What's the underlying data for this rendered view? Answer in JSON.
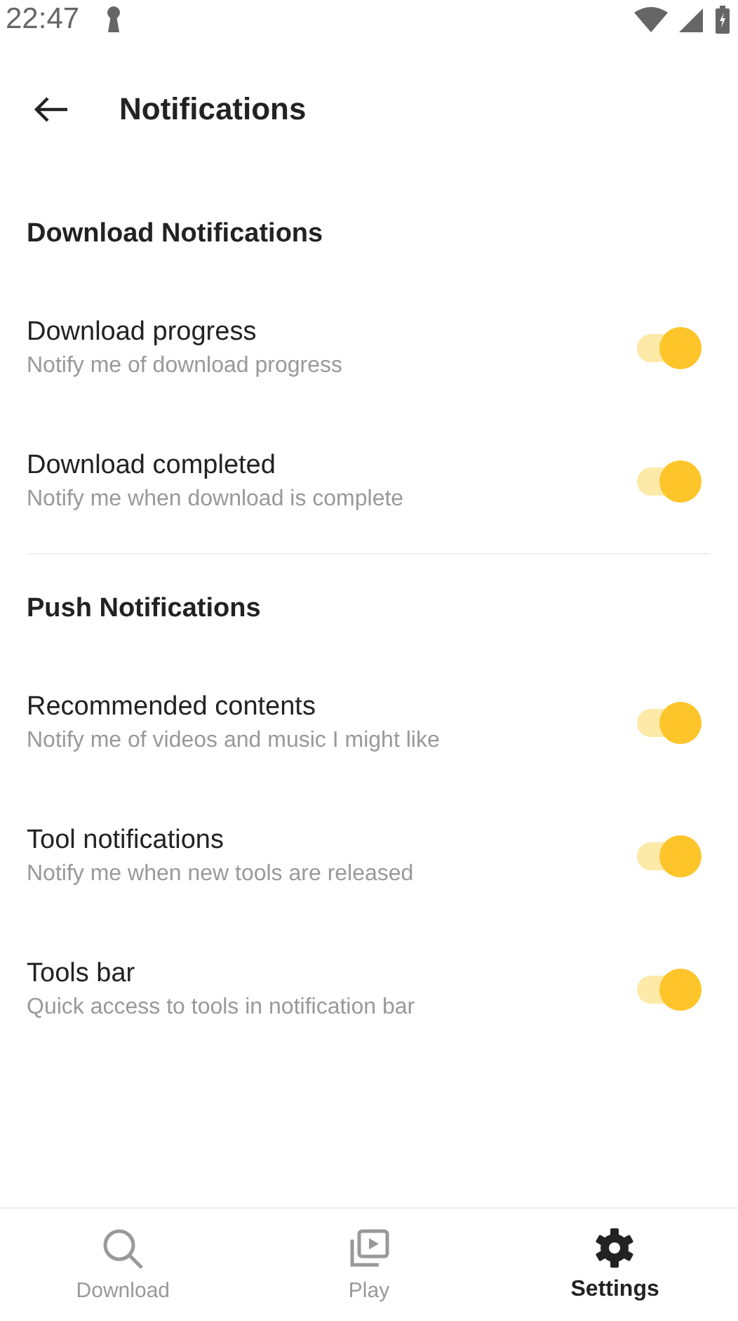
{
  "status_bar": {
    "time": "22:47"
  },
  "header": {
    "title": "Notifications"
  },
  "sections": [
    {
      "title": "Download Notifications",
      "items": [
        {
          "title": "Download progress",
          "subtitle": "Notify me of download progress",
          "on": true
        },
        {
          "title": "Download completed",
          "subtitle": "Notify me when download is complete",
          "on": true
        }
      ]
    },
    {
      "title": "Push Notifications",
      "items": [
        {
          "title": "Recommended contents",
          "subtitle": "Notify me of videos and music I might like",
          "on": true
        },
        {
          "title": "Tool notifications",
          "subtitle": "Notify me when new tools are released",
          "on": true
        },
        {
          "title": "Tools bar",
          "subtitle": "Quick access to tools in notification bar",
          "on": true
        }
      ]
    }
  ],
  "bottom_nav": [
    {
      "label": "Download",
      "kind": "search",
      "selected": false
    },
    {
      "label": "Play",
      "kind": "play",
      "selected": false
    },
    {
      "label": "Settings",
      "kind": "gear",
      "selected": true
    }
  ]
}
